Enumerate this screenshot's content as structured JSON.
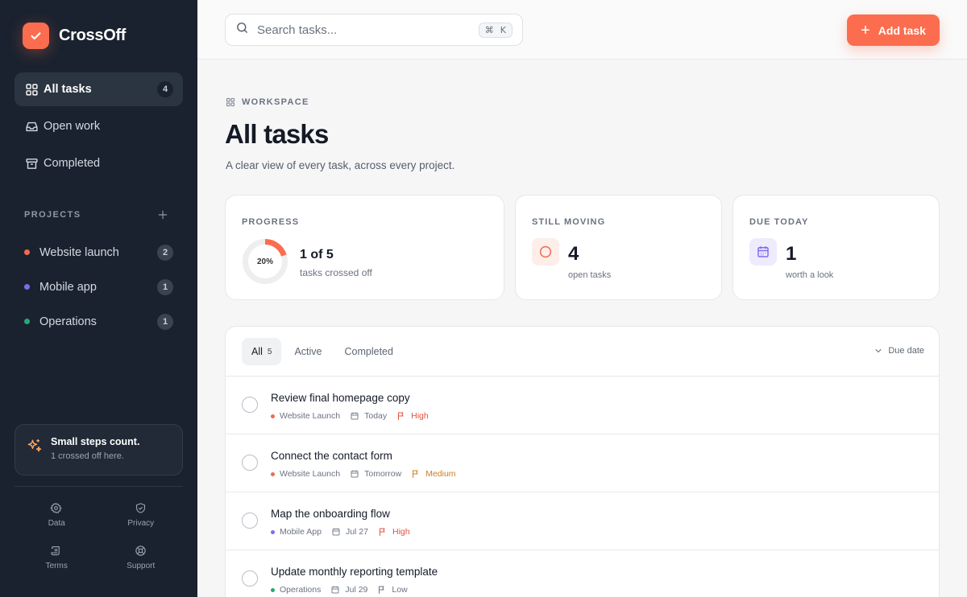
{
  "app": {
    "name": "CrossOff"
  },
  "sidebar": {
    "nav": [
      {
        "label": "All tasks",
        "count": "4",
        "icon": "grid-icon",
        "active": true
      },
      {
        "label": "Open work",
        "icon": "inbox-icon"
      },
      {
        "label": "Completed",
        "icon": "archive-icon"
      }
    ],
    "projects_title": "PROJECTS",
    "projects": [
      {
        "label": "Website launch",
        "count": "2",
        "color": "#f26a4f"
      },
      {
        "label": "Mobile app",
        "count": "1",
        "color": "#7f6bf0"
      },
      {
        "label": "Operations",
        "count": "1",
        "color": "#26a878"
      }
    ],
    "tip": {
      "title": "Small steps count.",
      "subtitle": "1 crossed off here."
    },
    "footer": [
      {
        "label": "Data",
        "icon": "gear-icon"
      },
      {
        "label": "Privacy",
        "icon": "shield-icon"
      },
      {
        "label": "Terms",
        "icon": "scroll-icon"
      },
      {
        "label": "Support",
        "icon": "lifebuoy-icon"
      }
    ]
  },
  "topbar": {
    "search_placeholder": "Search tasks...",
    "shortcut_cmd": "⌘",
    "shortcut_key": "K",
    "add_label": "Add task"
  },
  "page": {
    "eyebrow": "WORKSPACE",
    "title": "All tasks",
    "subtitle": "A clear view of every task, across every project."
  },
  "stats": {
    "progress": {
      "label": "PROGRESS",
      "percent_text": "20%",
      "fraction": 0.2,
      "value": "1 of 5",
      "note": "tasks crossed off"
    },
    "moving": {
      "label": "STILL MOVING",
      "value": "4",
      "note": "open tasks"
    },
    "due": {
      "label": "DUE TODAY",
      "value": "1",
      "note": "worth a look"
    }
  },
  "list": {
    "tabs": [
      {
        "label": "All",
        "count": "5",
        "active": true
      },
      {
        "label": "Active"
      },
      {
        "label": "Completed"
      }
    ],
    "sort_label": "Due date",
    "tasks": [
      {
        "title": "Review final homepage copy",
        "project": "Website Launch",
        "project_color": "#f26a4f",
        "due": "Today",
        "priority": "High",
        "priority_color": "#e0533b"
      },
      {
        "title": "Connect the contact form",
        "project": "Website Launch",
        "project_color": "#f26a4f",
        "due": "Tomorrow",
        "priority": "Medium",
        "priority_color": "#c98020"
      },
      {
        "title": "Map the onboarding flow",
        "project": "Mobile App",
        "project_color": "#7f6bf0",
        "due": "Jul 27",
        "priority": "High",
        "priority_color": "#e0533b"
      },
      {
        "title": "Update monthly reporting template",
        "project": "Operations",
        "project_color": "#26a878",
        "due": "Jul 29",
        "priority": "Low",
        "priority_color": "#6b7280"
      }
    ]
  },
  "colors": {
    "accent": "#fb6d4e",
    "sidebar_bg": "#1a222f"
  }
}
